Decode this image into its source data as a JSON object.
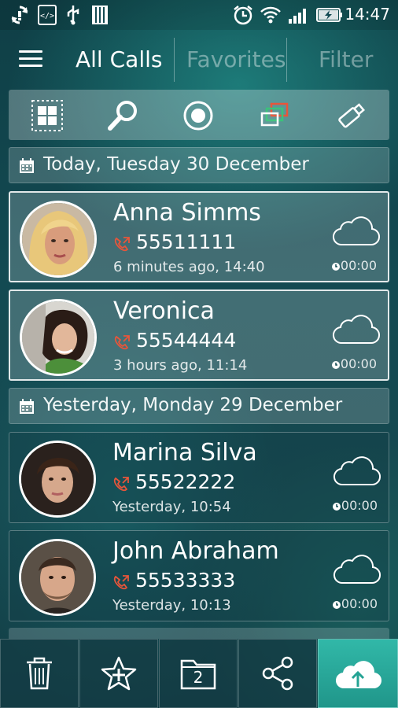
{
  "status_bar": {
    "time": "14:47",
    "left_icons": [
      "sync-icon",
      "code-icon",
      "usb-icon",
      "sd-card-icon"
    ],
    "right_icons": [
      "alarm-icon",
      "wifi-icon",
      "signal-icon",
      "battery-charging-icon"
    ]
  },
  "app_bar": {
    "menu_icon": "hamburger-menu-icon",
    "tabs": [
      {
        "label": "All Calls",
        "active": true
      },
      {
        "label": "Favorites",
        "active": false
      },
      {
        "label": "Filter",
        "active": false
      }
    ]
  },
  "toolbar": {
    "buttons": [
      "select-all-icon",
      "search-icon",
      "record-icon",
      "multi-window-icon",
      "usb-stick-icon"
    ]
  },
  "sections": [
    {
      "date": "Today, Tuesday 30 December",
      "calls": [
        {
          "name": "Anna Simms",
          "number": "55511111",
          "time": "6 minutes ago, 14:40",
          "duration": "00:00"
        },
        {
          "name": "Veronica",
          "number": "55544444",
          "time": "3 hours ago, 11:14",
          "duration": "00:00"
        }
      ]
    },
    {
      "date": "Yesterday, Monday 29 December",
      "calls": [
        {
          "name": "Marina Silva",
          "number": "55522222",
          "time": "Yesterday, 10:54",
          "duration": "00:00"
        },
        {
          "name": "John Abraham",
          "number": "55533333",
          "time": "Yesterday, 10:13",
          "duration": "00:00"
        }
      ]
    }
  ],
  "bottom_bar": {
    "buttons": [
      "trash-icon",
      "add-favorite-icon",
      "folder-icon",
      "share-icon",
      "cloud-upload-icon"
    ],
    "folder_count": "2"
  },
  "colors": {
    "accent": "#2fb3a4",
    "call_icon": "#e8553a",
    "background": "#134a52"
  }
}
